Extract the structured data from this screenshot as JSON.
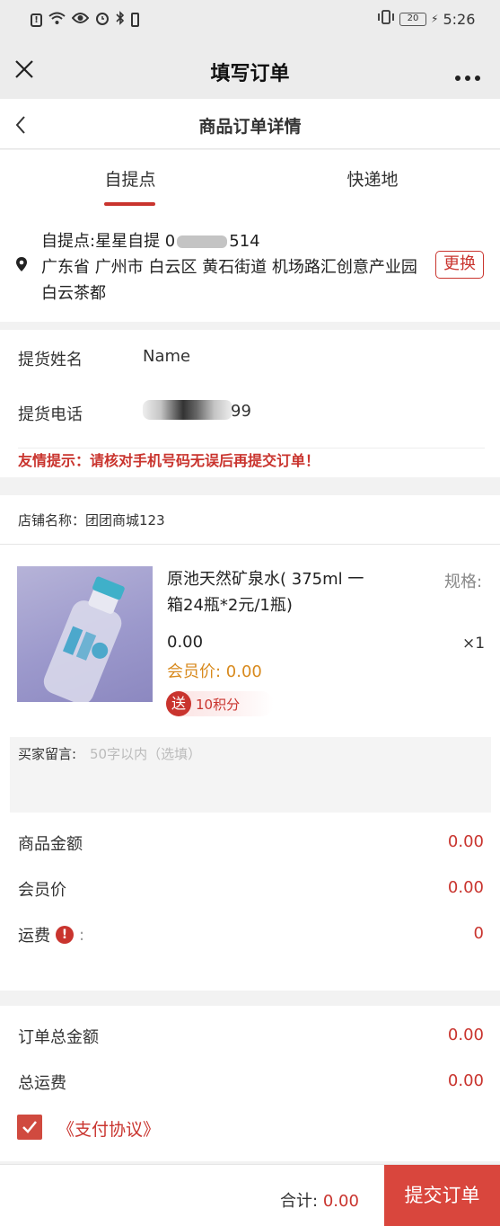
{
  "status": {
    "time": "5:26",
    "battery": "20",
    "left_icons": [
      "alert-icon",
      "wifi-icon",
      "eye-icon",
      "alarm-icon",
      "bluetooth-icon",
      "battery-saver-icon"
    ],
    "right_icons": [
      "vibrate-icon",
      "battery-icon",
      "charging-icon"
    ]
  },
  "window": {
    "title": "填写订单",
    "close_icon": "close-icon",
    "more_icon": "more-icon"
  },
  "header": {
    "title": "商品订单详情",
    "back_icon": "back-icon"
  },
  "tabs": [
    {
      "label": "自提点",
      "active": true
    },
    {
      "label": "快递地",
      "active": false
    }
  ],
  "pickup": {
    "name_line_prefix": "自提点:星星自提 0",
    "name_line_suffix": "514",
    "address": "广东省 广州市 白云区 黄石街道 机场路汇创意产业园白云茶都",
    "change_button": "更换",
    "location_icon": "location-pin-icon"
  },
  "form": {
    "name_label": "提货姓名",
    "name_value": "Name",
    "phone_label": "提货电话",
    "phone_suffix": "99"
  },
  "notice": "友情提示：请核对手机号码无误后再提交订单！",
  "store": {
    "label": "店铺名称：",
    "name": "团团商城123"
  },
  "product": {
    "title": "原池天然矿泉水( 375ml 一箱24瓶*2元/1瓶)",
    "spec_label": "规格:",
    "price": "0.00",
    "quantity": "×1",
    "member_price_label": "会员价: 0.00",
    "gift_badge": "送",
    "gift_points": "10积分"
  },
  "message": {
    "label": "买家留言:",
    "placeholder": "50字以内（选填）"
  },
  "summary": [
    {
      "label": "商品金额",
      "value": "0.00"
    },
    {
      "label": "会员价",
      "value": "0.00"
    },
    {
      "label": "运费",
      "value": "0"
    }
  ],
  "shipping_info_icon": "info-icon",
  "totals": [
    {
      "label": "订单总金额",
      "value": "0.00"
    },
    {
      "label": "总运费",
      "value": "0.00"
    }
  ],
  "agreement": {
    "label": "《支付协议》",
    "checked": true
  },
  "footer": {
    "total_label": "合计:",
    "total_value": "0.00",
    "submit": "提交订单"
  },
  "colors": {
    "accent": "#c9342e",
    "gold": "#d88a1e",
    "background": "#f2f2f2"
  }
}
